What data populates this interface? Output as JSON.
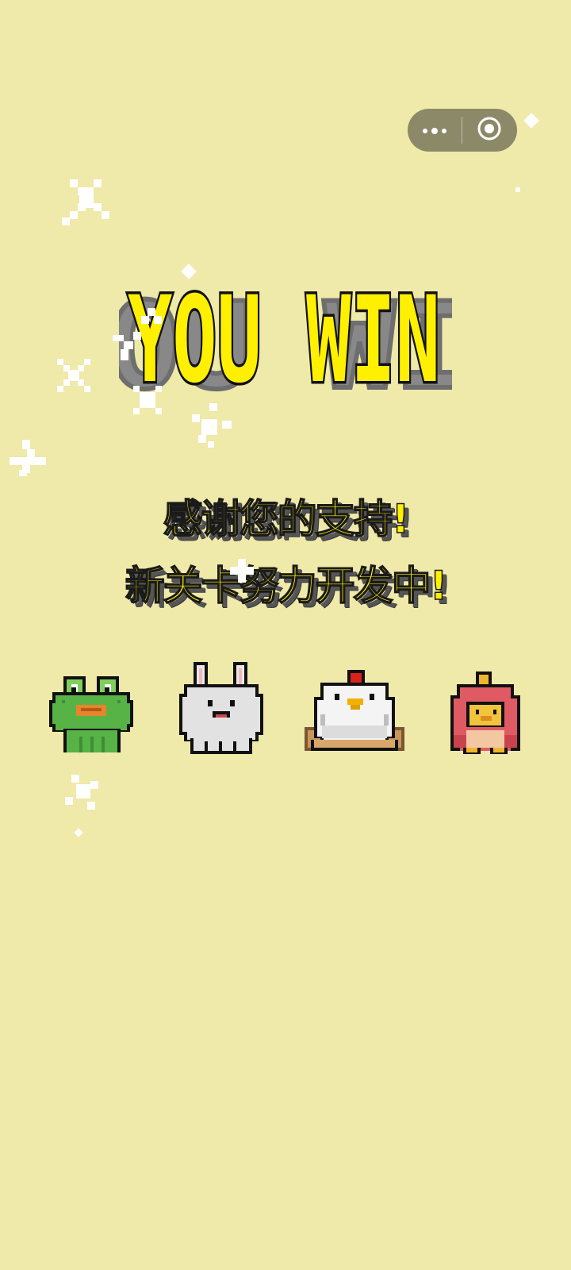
{
  "screen": {
    "background": "#EFE9AA",
    "accent": "#FFF000"
  },
  "capsule": {
    "more_icon": "more-dots-icon",
    "close_icon": "target-circle-icon",
    "color": "#8B8968"
  },
  "title": {
    "text": "YOU WIN",
    "fill": "#FFF000",
    "outline": "#111111",
    "shadow": "#9A9A9A"
  },
  "message": {
    "line1": "感谢您的支持!",
    "line2": "新关卡努力开发中!"
  },
  "characters": [
    {
      "name": "frog",
      "icon": "frog-icon",
      "color": "#58B347"
    },
    {
      "name": "rabbit",
      "icon": "rabbit-icon",
      "color": "#E2E2E2"
    },
    {
      "name": "chicken",
      "icon": "chicken-icon",
      "color": "#F1F1F1"
    },
    {
      "name": "duck-in-costume",
      "icon": "red-costume-duck-icon",
      "color": "#E05A63"
    }
  ],
  "effects": {
    "sparkle_icon": "sparkle-icon",
    "sparkle_color": "#FFFFFF"
  }
}
